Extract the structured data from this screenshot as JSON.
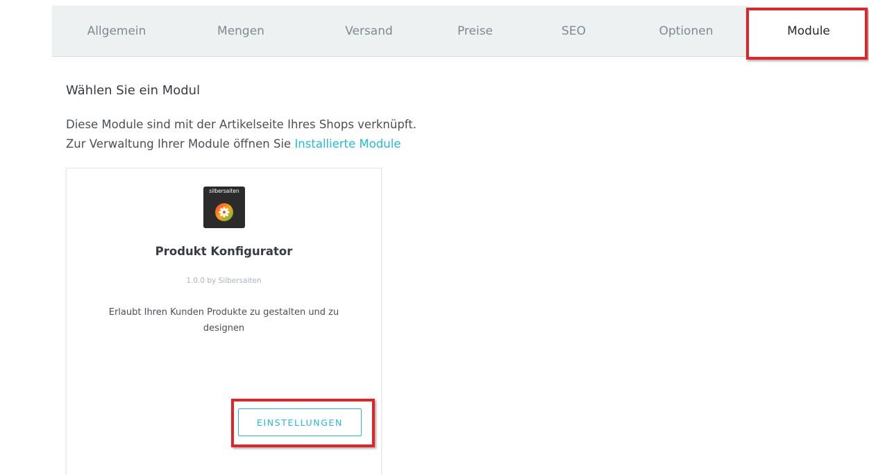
{
  "tabs": [
    {
      "label": "Allgemein",
      "active": false
    },
    {
      "label": "Mengen",
      "active": false
    },
    {
      "label": "Versand",
      "active": false
    },
    {
      "label": "Preise",
      "active": false
    },
    {
      "label": "SEO",
      "active": false
    },
    {
      "label": "Optionen",
      "active": false
    },
    {
      "label": "Module",
      "active": true
    }
  ],
  "main": {
    "heading": "Wählen Sie ein Modul",
    "description_line1": "Diese Module sind mit der Artikelseite Ihres Shops verknüpft.",
    "description_line2_prefix": "Zur Verwaltung Ihrer Module öffnen Sie",
    "description_link": "Installierte Module"
  },
  "module_card": {
    "logo_text": "silbersaiten",
    "logo_icon": "gear-icon",
    "title": "Produkt Konfigurator",
    "version": "1.0.0 by Silbersaiten",
    "description": "Erlaubt Ihren Kunden Produkte zu gestalten und zu designen",
    "settings_label": "EINSTELLUNGEN"
  },
  "colors": {
    "accent": "#25b9d7",
    "highlight": "#e0242a",
    "tabbar_bg": "#eef1f2"
  }
}
